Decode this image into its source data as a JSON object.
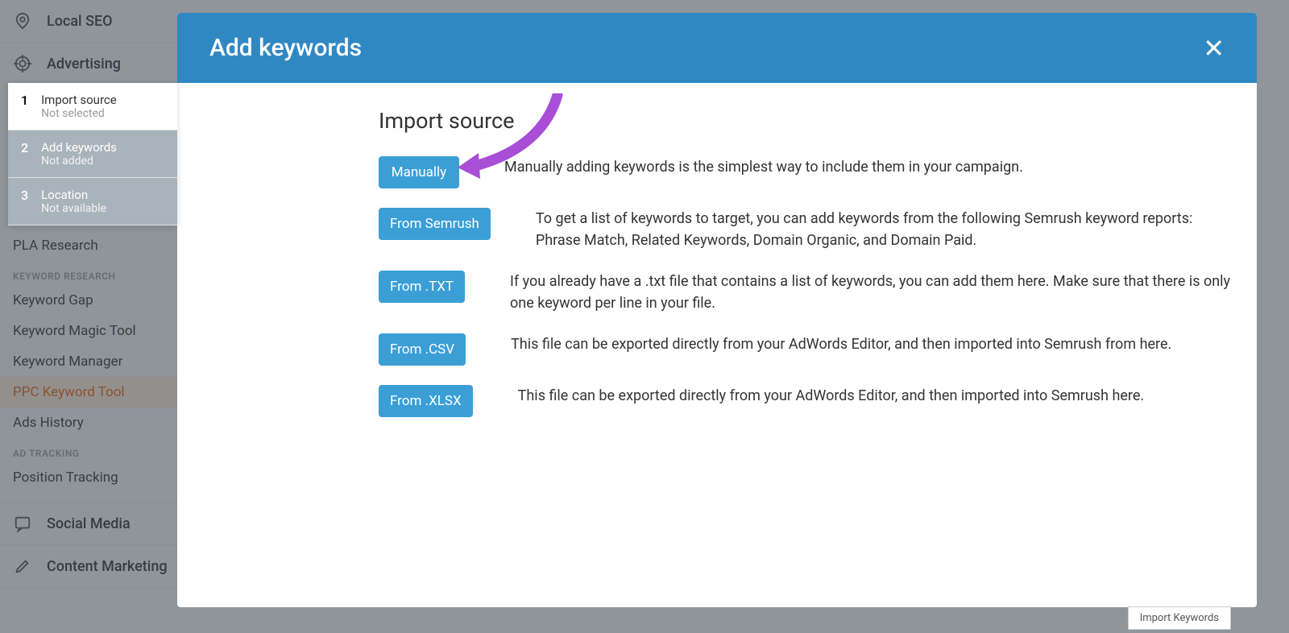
{
  "sidebar": {
    "main": [
      {
        "label": "Local SEO"
      },
      {
        "label": "Advertising"
      }
    ],
    "subItems1": [
      {
        "label": "PLA Research"
      }
    ],
    "category1": "KEYWORD RESEARCH",
    "subItems2": [
      {
        "label": "Keyword Gap"
      },
      {
        "label": "Keyword Magic Tool"
      },
      {
        "label": "Keyword Manager"
      },
      {
        "label": "PPC Keyword Tool"
      },
      {
        "label": "Ads History"
      }
    ],
    "category2": "AD TRACKING",
    "subItems3": [
      {
        "label": "Position Tracking"
      }
    ],
    "main2": [
      {
        "label": "Social Media"
      },
      {
        "label": "Content Marketing"
      }
    ]
  },
  "modal": {
    "title": "Add keywords",
    "sectionTitle": "Import source",
    "options": [
      {
        "btn": "Manually",
        "desc": "Manually adding keywords is the simplest way to include them in your campaign."
      },
      {
        "btn": "From Semrush",
        "desc": "To get a list of keywords to target, you can add keywords from the following Semrush keyword reports: Phrase Match, Related Keywords, Domain Organic, and Domain Paid."
      },
      {
        "btn": "From .TXT",
        "desc": "If you already have a .txt file that contains a list of keywords, you can add them here. Make sure that there is only one keyword per line in your file."
      },
      {
        "btn": "From .CSV",
        "desc": "This file can be exported directly from your AdWords Editor, and then imported into Semrush from here."
      },
      {
        "btn": "From .XLSX",
        "desc": "This file can be exported directly from your AdWords Editor, and then imported into Semrush here."
      }
    ]
  },
  "wizard": {
    "steps": [
      {
        "num": "1",
        "title": "Import source",
        "sub": "Not selected"
      },
      {
        "num": "2",
        "title": "Add keywords",
        "sub": "Not added"
      },
      {
        "num": "3",
        "title": "Location",
        "sub": "Not available"
      }
    ]
  },
  "footerBtn": "Import Keywords"
}
